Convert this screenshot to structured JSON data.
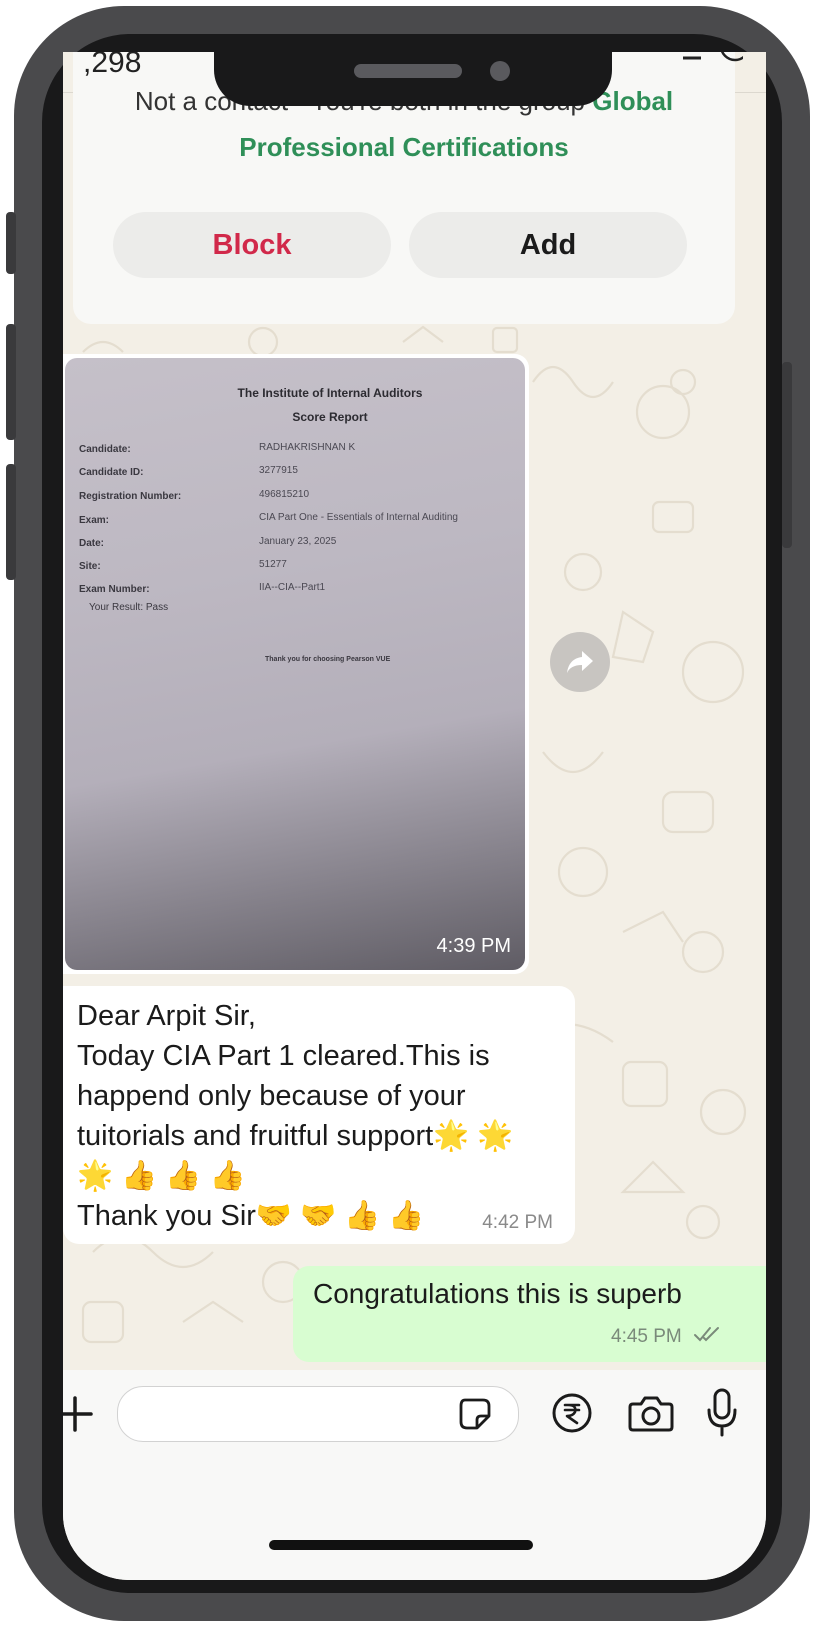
{
  "status": {
    "time_fragment": ",298"
  },
  "contact_card": {
    "notice_prefix": "Not a contact · You're both in the group",
    "group_name_first": "Global",
    "group_name_rest": "Professional Certifications",
    "block_label": "Block",
    "add_label": "Add"
  },
  "image_message": {
    "document": {
      "title": "The Institute of Internal Auditors",
      "subtitle": "Score Report",
      "rows": [
        {
          "label": "Candidate:",
          "value": "RADHAKRISHNAN K"
        },
        {
          "label": "Candidate ID:",
          "value": "3277915"
        },
        {
          "label": "Registration Number:",
          "value": "496815210"
        },
        {
          "label": "Exam:",
          "value": "CIA Part One - Essentials of Internal Auditing"
        },
        {
          "label": "Date:",
          "value": "January 23, 2025"
        },
        {
          "label": "Site:",
          "value": "51277"
        },
        {
          "label": "Exam Number:",
          "value": "IIA--CIA--Part1"
        }
      ],
      "result": "Your Result: Pass",
      "footer": "Thank you for choosing Pearson VUE"
    },
    "time": "4:39 PM"
  },
  "incoming_message": {
    "lines": [
      "Dear Arpit Sir,",
      "Today CIA Part 1 cleared.This is",
      "happend only because of your",
      "tuitorials and fruitful support🌟 🌟",
      "🌟 👍 👍 👍",
      "Thank you Sir🤝 🤝 👍 👍"
    ],
    "time": "4:42 PM"
  },
  "outgoing_message": {
    "text": "Congratulations this is superb",
    "time": "4:45 PM"
  },
  "input": {
    "placeholder": ""
  },
  "icons": {
    "forward": "forward-icon",
    "plus": "plus-icon",
    "sticker": "sticker-icon",
    "payment": "rupee-icon",
    "camera": "camera-icon",
    "mic": "microphone-icon",
    "read_receipt": "double-check-icon"
  },
  "colors": {
    "block_red": "#d1294a",
    "group_green": "#2f8f58",
    "outgoing_bubble": "#d8fdd1",
    "chat_bg": "#f3efe6"
  }
}
